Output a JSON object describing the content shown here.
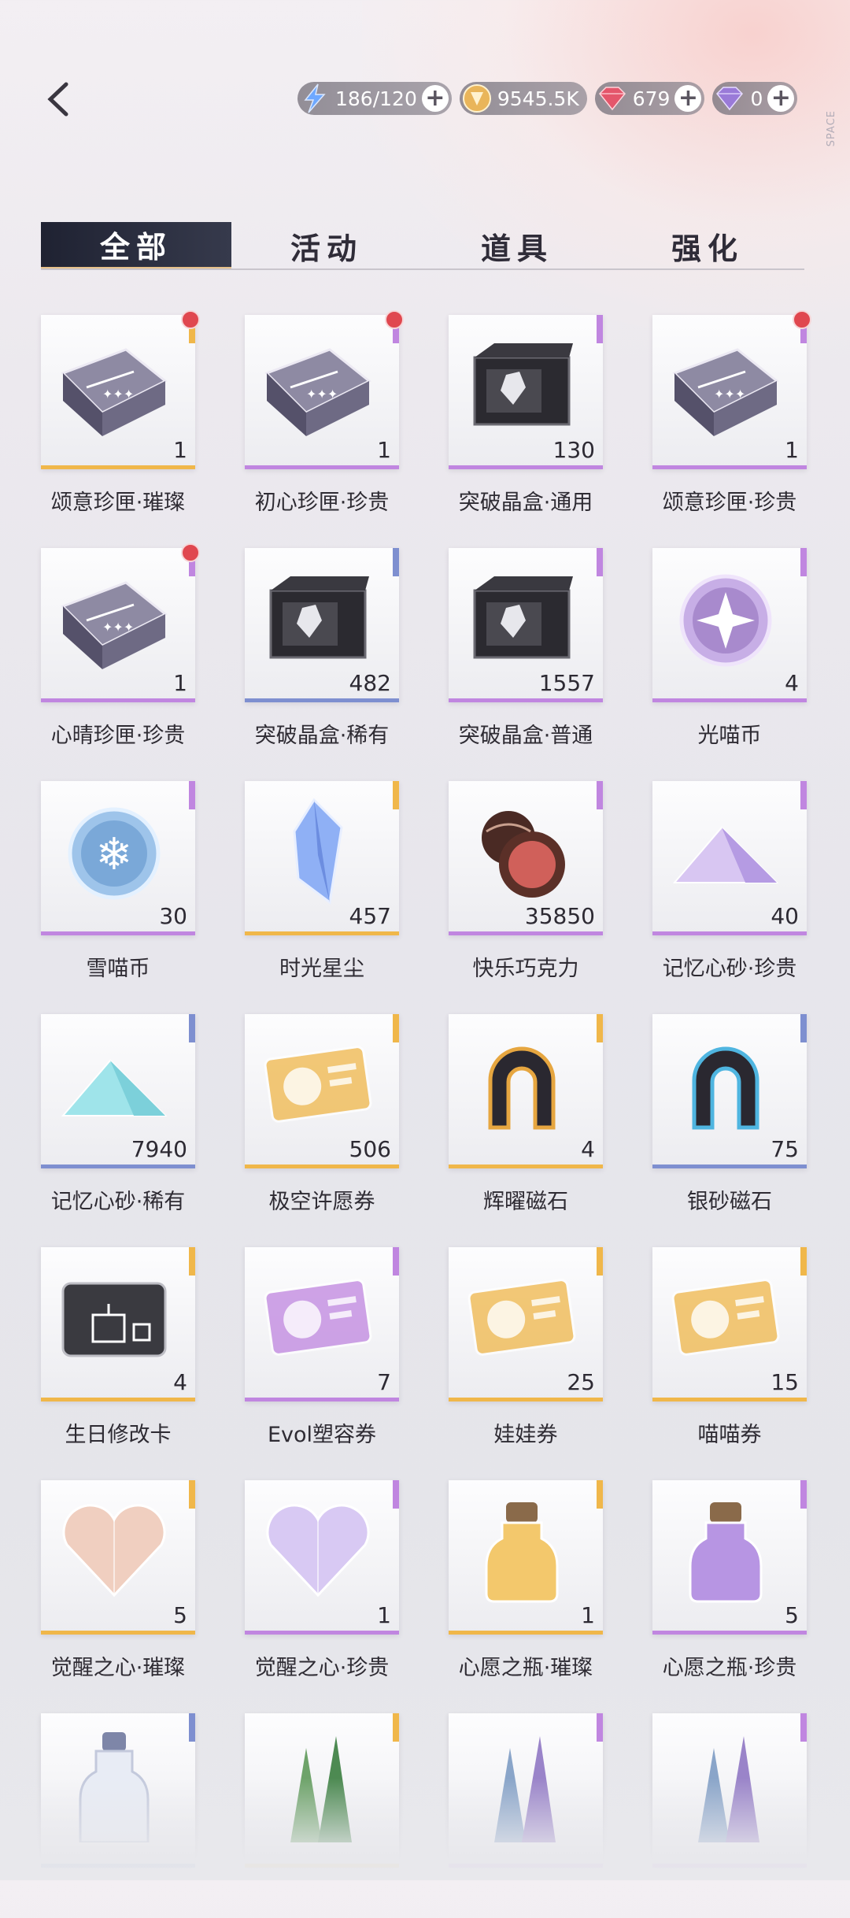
{
  "colors": {
    "gold": "#f0b74a",
    "purple": "#c086e0",
    "blue": "#7e8fd0",
    "tab_active_bg": "#1f2232",
    "notif": "#e0474f"
  },
  "header": {
    "back_icon": "chevron-left-icon",
    "side_tag": "SPACE"
  },
  "currencies": [
    {
      "icon": "stamina-icon",
      "value": "186/120"
    },
    {
      "icon": "gold-coin-icon",
      "value": "9545.5K"
    },
    {
      "icon": "red-diamond-icon",
      "value": "679"
    },
    {
      "icon": "purple-diamond-icon",
      "value": "0"
    }
  ],
  "tabs": [
    {
      "label": "全部",
      "active": true
    },
    {
      "label": "活动",
      "active": false
    },
    {
      "label": "道具",
      "active": false
    },
    {
      "label": "强化",
      "active": false
    }
  ],
  "items": [
    {
      "name": "颂意珍匣·璀璨",
      "qty": "1",
      "rarity": "gold",
      "icon": "gift-case-icon",
      "notify": true
    },
    {
      "name": "初心珍匣·珍贵",
      "qty": "1",
      "rarity": "purple",
      "icon": "gift-case-icon",
      "notify": true
    },
    {
      "name": "突破晶盒·通用",
      "qty": "130",
      "rarity": "purple",
      "icon": "crystal-box-icon",
      "notify": false
    },
    {
      "name": "颂意珍匣·珍贵",
      "qty": "1",
      "rarity": "purple",
      "icon": "gift-case-icon",
      "notify": true
    },
    {
      "name": "心晴珍匣·珍贵",
      "qty": "1",
      "rarity": "purple",
      "icon": "gift-case-icon",
      "notify": true
    },
    {
      "name": "突破晶盒·稀有",
      "qty": "482",
      "rarity": "blue",
      "icon": "crystal-box-icon",
      "notify": false
    },
    {
      "name": "突破晶盒·普通",
      "qty": "1557",
      "rarity": "purple",
      "icon": "crystal-box-icon",
      "notify": false
    },
    {
      "name": "光喵币",
      "qty": "4",
      "rarity": "purple",
      "icon": "star-coin-icon",
      "notify": false
    },
    {
      "name": "雪喵币",
      "qty": "30",
      "rarity": "purple",
      "icon": "snow-coin-icon",
      "notify": false
    },
    {
      "name": "时光星尘",
      "qty": "457",
      "rarity": "gold",
      "icon": "crystal-icon",
      "notify": false
    },
    {
      "name": "快乐巧克力",
      "qty": "35850",
      "rarity": "purple",
      "icon": "chocolate-icon",
      "notify": false
    },
    {
      "name": "记忆心砂·珍贵",
      "qty": "40",
      "rarity": "purple",
      "icon": "sand-pile-icon",
      "notify": false
    },
    {
      "name": "记忆心砂·稀有",
      "qty": "7940",
      "rarity": "blue",
      "icon": "sand-pile-icon",
      "notify": false
    },
    {
      "name": "极空许愿券",
      "qty": "506",
      "rarity": "gold",
      "icon": "ticket-icon",
      "notify": false
    },
    {
      "name": "辉曜磁石",
      "qty": "4",
      "rarity": "gold",
      "icon": "magnet-icon",
      "notify": false
    },
    {
      "name": "银砂磁石",
      "qty": "75",
      "rarity": "blue",
      "icon": "magnet-icon",
      "notify": false
    },
    {
      "name": "生日修改卡",
      "qty": "4",
      "rarity": "gold",
      "icon": "birthday-card-icon",
      "notify": false
    },
    {
      "name": "Evol塑容券",
      "qty": "7",
      "rarity": "purple",
      "icon": "ticket-icon",
      "notify": false
    },
    {
      "name": "娃娃券",
      "qty": "25",
      "rarity": "gold",
      "icon": "ticket-icon",
      "notify": false
    },
    {
      "name": "喵喵券",
      "qty": "15",
      "rarity": "gold",
      "icon": "ticket-icon",
      "notify": false
    },
    {
      "name": "觉醒之心·璀璨",
      "qty": "5",
      "rarity": "gold",
      "icon": "heart-gem-icon",
      "notify": false
    },
    {
      "name": "觉醒之心·珍贵",
      "qty": "1",
      "rarity": "purple",
      "icon": "heart-gem-icon",
      "notify": false
    },
    {
      "name": "心愿之瓶·璀璨",
      "qty": "1",
      "rarity": "gold",
      "icon": "wish-bottle-icon",
      "notify": false
    },
    {
      "name": "心愿之瓶·珍贵",
      "qty": "5",
      "rarity": "purple",
      "icon": "wish-bottle-icon",
      "notify": false
    },
    {
      "name": "",
      "qty": "",
      "rarity": "blue",
      "icon": "bottle-icon",
      "notify": false
    },
    {
      "name": "",
      "qty": "",
      "rarity": "gold",
      "icon": "crystal-shard-icon",
      "notify": false
    },
    {
      "name": "",
      "qty": "",
      "rarity": "purple",
      "icon": "crystal-shard-icon",
      "notify": false
    },
    {
      "name": "",
      "qty": "",
      "rarity": "purple",
      "icon": "crystal-shard-icon",
      "notify": false
    }
  ]
}
